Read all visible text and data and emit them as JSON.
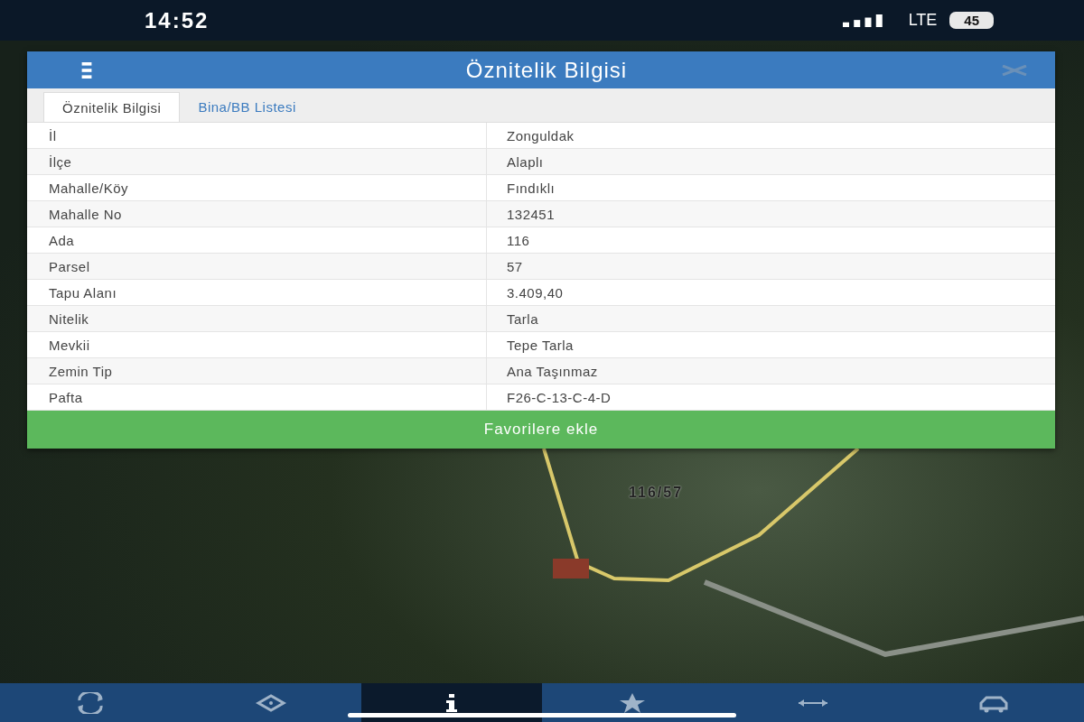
{
  "status_bar": {
    "time": "14:52",
    "network": "LTE",
    "battery": "45"
  },
  "map": {
    "parcel_label": "116/57"
  },
  "dialog": {
    "title": "Öznitelik Bilgisi",
    "tabs": [
      {
        "label": "Öznitelik Bilgisi",
        "selected": true
      },
      {
        "label": "Bina/BB Listesi",
        "selected": false
      }
    ],
    "rows": [
      {
        "field": "İl",
        "value": "Zonguldak"
      },
      {
        "field": "İlçe",
        "value": "Alaplı"
      },
      {
        "field": "Mahalle/Köy",
        "value": "Fındıklı"
      },
      {
        "field": "Mahalle No",
        "value": "132451"
      },
      {
        "field": "Ada",
        "value": "116"
      },
      {
        "field": "Parsel",
        "value": "57"
      },
      {
        "field": "Tapu Alanı",
        "value": "3.409,40"
      },
      {
        "field": "Nitelik",
        "value": "Tarla"
      },
      {
        "field": "Mevkii",
        "value": "Tepe Tarla"
      },
      {
        "field": "Zemin Tip",
        "value": "Ana Taşınmaz"
      },
      {
        "field": "Pafta",
        "value": "F26-C-13-C-4-D"
      }
    ],
    "action": "Favorilere ekle"
  },
  "bottom_nav": [
    {
      "kind": "refresh",
      "selected": false
    },
    {
      "kind": "target",
      "selected": false
    },
    {
      "kind": "info",
      "selected": true
    },
    {
      "kind": "star",
      "selected": false
    },
    {
      "kind": "measure",
      "selected": false
    },
    {
      "kind": "car",
      "selected": false
    }
  ]
}
